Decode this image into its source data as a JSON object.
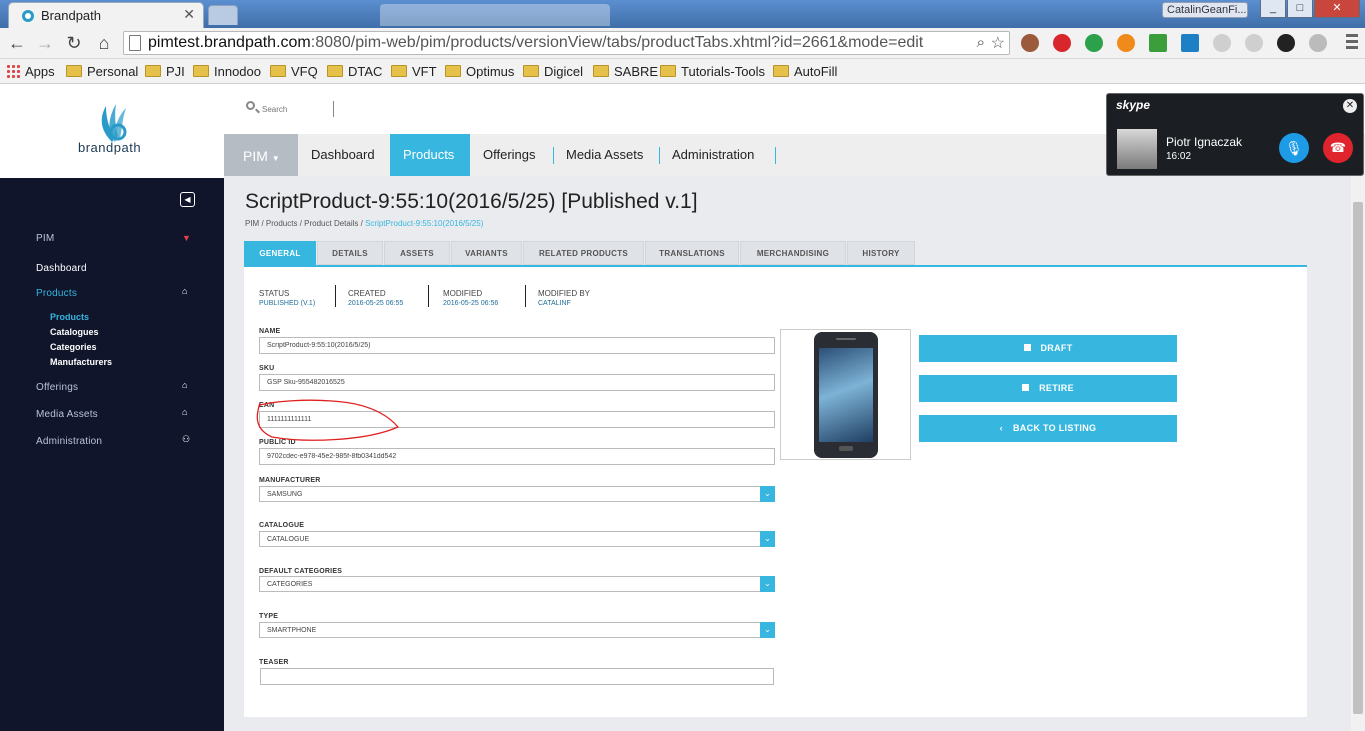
{
  "browser": {
    "tab_title": "Brandpath",
    "user_badge": "CatalinGeanFi...",
    "url_host": "pimtest.brandpath.com",
    "url_rest": ":8080/pim-web/pim/products/versionView/tabs/productTabs.xhtml?id=2661&mode=edit",
    "bookmarks": [
      "Apps",
      "Personal",
      "PJI",
      "Innodoo",
      "VFQ",
      "DTAC",
      "VFT",
      "Optimus",
      "Digicel",
      "SABRE",
      "Tutorials-Tools",
      "AutoFill"
    ]
  },
  "app": {
    "brand": "brandpath",
    "search_placeholder": "Search",
    "nav": {
      "pim_label": "PIM",
      "items": [
        "Dashboard",
        "Products",
        "Offerings",
        "Media Assets",
        "Administration"
      ],
      "active": "Products"
    },
    "sidebar": {
      "pim": "PIM",
      "dashboard": "Dashboard",
      "products": "Products",
      "sub_products": "Products",
      "sub_catalogues": "Catalogues",
      "sub_categories": "Categories",
      "sub_manufacturers": "Manufacturers",
      "offerings": "Offerings",
      "media_assets": "Media Assets",
      "administration": "Administration"
    },
    "page": {
      "title": "ScriptProduct-9:55:10(2016/5/25) [Published v.1]",
      "breadcrumb": [
        "PIM",
        "Products",
        "Product Details"
      ],
      "breadcrumb_current": "ScriptProduct-9:55:10(2016/5/25)",
      "tabs": [
        "GENERAL",
        "DETAILS",
        "ASSETS",
        "VARIANTS",
        "RELATED PRODUCTS",
        "TRANSLATIONS",
        "MERCHANDISING",
        "HISTORY"
      ],
      "active_tab": "GENERAL"
    },
    "meta": {
      "status_label": "STATUS",
      "status_value": "PUBLISHED (V.1)",
      "created_label": "CREATED",
      "created_value": "2016-05-25 06:55",
      "modified_label": "MODIFIED",
      "modified_value": "2016-05-25 06:56",
      "modifiedby_label": "MODIFIED BY",
      "modifiedby_value": "CATALINF"
    },
    "form": {
      "name_label": "NAME",
      "name_value": "ScriptProduct-9:55:10(2016/5/25)",
      "sku_label": "SKU",
      "sku_value": "GSP Sku-955482016525",
      "ean_label": "EAN",
      "ean_value": "1111111111111",
      "publicid_label": "PUBLIC ID",
      "publicid_value": "9702cdec-e978-45e2-985f-8fb0341dd542",
      "manufacturer_label": "MANUFACTURER",
      "manufacturer_value": "SAMSUNG",
      "catalogue_label": "CATALOGUE",
      "catalogue_value": "CATALOGUE",
      "defcat_label": "DEFAULT CATEGORIES",
      "defcat_value": "CATEGORIES",
      "type_label": "TYPE",
      "type_value": "SMARTPHONE",
      "teaser_label": "TEASER",
      "teaser_value": ""
    },
    "actions": {
      "draft": "DRAFT",
      "retire": "RETIRE",
      "back": "BACK TO LISTING"
    }
  },
  "skype": {
    "brand": "skype",
    "caller": "Piotr Ignaczak",
    "duration": "16:02"
  },
  "colors": {
    "accent": "#37b7df",
    "sidebar_bg": "#10152b",
    "annotation_red": "#e02020"
  }
}
